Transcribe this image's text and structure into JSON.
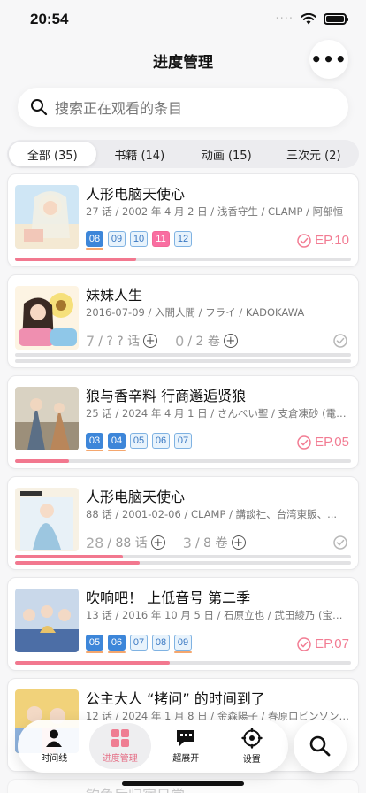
{
  "status_bar": {
    "time": "20:54",
    "signal_dots": "····"
  },
  "header": {
    "title": "进度管理",
    "more_label": "•••"
  },
  "search": {
    "placeholder": "搜索正在观看的条目"
  },
  "tabs": [
    {
      "label": "全部 (35)",
      "active": true
    },
    {
      "label": "书籍 (14)",
      "active": false
    },
    {
      "label": "动画 (15)",
      "active": false
    },
    {
      "label": "三次元 (2)",
      "active": false
    }
  ],
  "items": [
    {
      "title": "人形电脑天使心",
      "meta": "27 话 / 2002 年 4 月 2 日 / 浅香守生 / CLAMP / 阿部恒",
      "kind": "episodes",
      "episodes": [
        {
          "num": "08",
          "state": "watched"
        },
        {
          "num": "09",
          "state": "aired"
        },
        {
          "num": "10",
          "state": "aired"
        },
        {
          "num": "11",
          "state": "current"
        },
        {
          "num": "12",
          "state": "aired"
        }
      ],
      "next_ep": "EP.10",
      "progress": 0.36,
      "cover_colors": [
        "#cfe6f5",
        "#f4e9d3",
        "#f2c7b8"
      ]
    },
    {
      "title": "妹妹人生",
      "meta": "2016-07-09 / 入間人間 / フライ / KADOKAWA",
      "kind": "counter",
      "current": "7",
      "total_label": "/ ? ? 话",
      "vol_current": "0",
      "vol_total_label": "/ 2 卷",
      "progress": 0,
      "cover_colors": [
        "#f6e07a",
        "#8fc7e8",
        "#ef8fb0"
      ]
    },
    {
      "title": "狼与香辛料 行商邂逅贤狼",
      "meta": "25 话 / 2024 年 4 月 1 日 / さんぺい聖 / 支倉凍砂 (電撃...",
      "kind": "episodes",
      "episodes": [
        {
          "num": "03",
          "state": "watched"
        },
        {
          "num": "04",
          "state": "watched"
        },
        {
          "num": "05",
          "state": "aired"
        },
        {
          "num": "06",
          "state": "aired"
        },
        {
          "num": "07",
          "state": "aired"
        }
      ],
      "next_ep": "EP.05",
      "progress": 0.16,
      "cover_colors": [
        "#9c8f7a",
        "#d9d2c2",
        "#5b6f86"
      ]
    },
    {
      "title": "人形电脑天使心",
      "meta": "88 话 / 2001-02-06 / CLAMP / 講談社、台湾東販、...",
      "kind": "counter",
      "current": "28",
      "total_label": "/ 88 话",
      "vol_current": "3",
      "vol_total_label": "/ 8 卷",
      "progress": 0.32,
      "progress2": 0.37,
      "cover_colors": [
        "#e8f1f7",
        "#9cc6e0",
        "#f7f1e4"
      ]
    },
    {
      "title": "吹响吧！ 上低音号 第二季",
      "meta": "13 话 / 2016 年 10 月 5 日 / 石原立也 / 武田綾乃 (宝島社...",
      "kind": "episodes",
      "episodes": [
        {
          "num": "05",
          "state": "watched"
        },
        {
          "num": "06",
          "state": "watched"
        },
        {
          "num": "07",
          "state": "aired"
        },
        {
          "num": "08",
          "state": "aired"
        },
        {
          "num": "09",
          "state": "aired"
        }
      ],
      "next_ep": "EP.07",
      "progress": 0.46,
      "cover_colors": [
        "#4c6ea6",
        "#e8c36a",
        "#c9d8ea"
      ]
    },
    {
      "title": "公主大人 “拷问” 的时间到了",
      "meta": "12 话 / 2024 年 1 月 8 日 / 金森陽子 / 春原ロビンソン・ひ...",
      "kind": "partial",
      "cover_colors": [
        "#f1d27a",
        "#8fb3de",
        "#e89a9a"
      ]
    }
  ],
  "partial_item_title": "钓鱼后归宿日常",
  "bottom_nav": [
    {
      "label": "时间线",
      "icon": "person-icon",
      "active": false
    },
    {
      "label": "进度管理",
      "icon": "grid-icon",
      "active": true
    },
    {
      "label": "超展开",
      "icon": "chat-icon",
      "active": false
    },
    {
      "label": "设置",
      "icon": "settings-icon",
      "active": false
    }
  ],
  "colors": {
    "accent": "#f2788f",
    "watched": "#3d86d9",
    "aired_border": "#7fb2e2",
    "current": "#f96ea1"
  }
}
